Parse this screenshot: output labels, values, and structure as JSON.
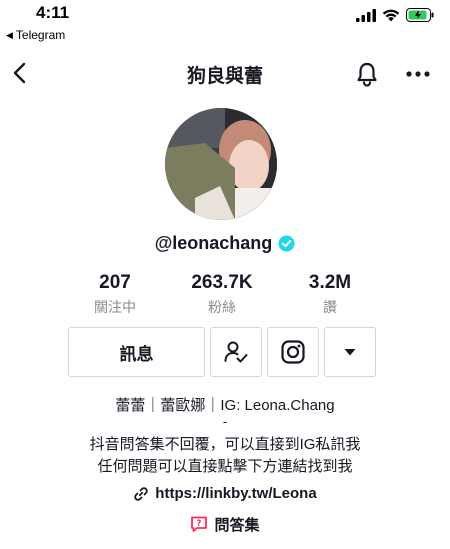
{
  "status_bar": {
    "time": "4:11",
    "back_app_label": "Telegram"
  },
  "nav": {
    "title": "狗良與蕾"
  },
  "profile": {
    "username": "@leonachang",
    "verified": true,
    "verified_color": "#20d5ec"
  },
  "stats": [
    {
      "value": "207",
      "label": "關注中"
    },
    {
      "value": "263.7K",
      "label": "粉絲"
    },
    {
      "value": "3.2M",
      "label": "讚"
    }
  ],
  "actions": {
    "message_label": "訊息"
  },
  "bio": {
    "line1": "蕾蕾｜蕾歐娜｜IG: Leona.Chang",
    "line2": "-",
    "line3": "抖音問答集不回覆，可以直接到IG私訊我",
    "line4": "任何問題可以直接點擊下方連結找到我"
  },
  "link": {
    "text": "https://linkby.tw/Leona"
  },
  "qa": {
    "label": "問答集",
    "icon_color": "#fe2c55"
  },
  "battery_color": "#34c759"
}
